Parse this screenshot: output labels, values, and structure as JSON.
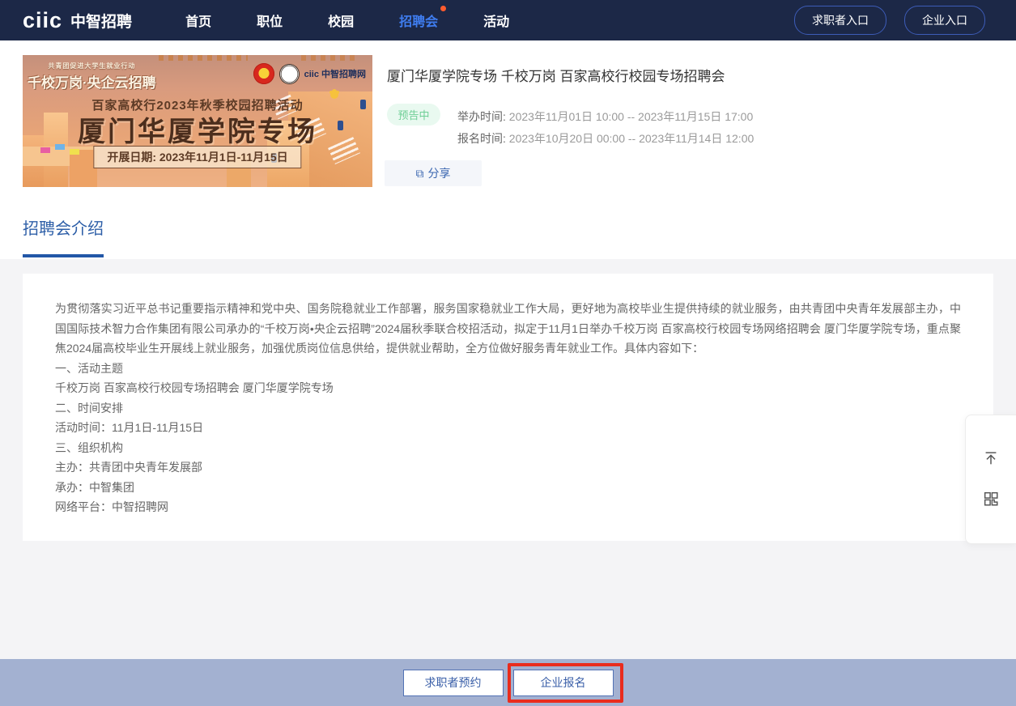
{
  "header": {
    "logo": "ciic",
    "brand": "中智招聘",
    "nav": [
      {
        "label": "首页",
        "active": false
      },
      {
        "label": "职位",
        "active": false
      },
      {
        "label": "校园",
        "active": false
      },
      {
        "label": "招聘会",
        "active": true,
        "has_dot": true
      },
      {
        "label": "活动",
        "active": false
      }
    ],
    "entry_buttons": {
      "jobseeker": "求职者入口",
      "company": "企业入口"
    }
  },
  "banner": {
    "tagline_small": "共青团促进大学生就业行动",
    "tagline": "千校万岗·央企云招聘",
    "brand": "ciic 中智招聘网",
    "subtitle": "百家高校行2023年秋季校园招聘活动",
    "title": "厦门华厦学院专场",
    "date_box": "开展日期: 2023年11月1日-11月15日"
  },
  "event": {
    "title": "厦门华厦学院专场 千校万岗 百家高校行校园专场招聘会",
    "status_badge": "预告中",
    "hold_time_label": "举办时间:",
    "hold_time_value": "2023年11月01日 10:00 -- 2023年11月15日 17:00",
    "signup_time_label": "报名时间:",
    "signup_time_value": "2023年10月20日 00:00 -- 2023年11月14日 12:00",
    "share_icon": "share-icon",
    "share_label": "分享"
  },
  "tab": {
    "intro": "招聘会介绍"
  },
  "article": {
    "lines": [
      "为贯彻落实习近平总书记重要指示精神和党中央、国务院稳就业工作部署，服务国家稳就业工作大局，更好地为高校毕业生提供持续的就业服务，由共青团中央青年发展部主办，中国国际技术智力合作集团有限公司承办的“千校万岗•央企云招聘”2024届秋季联合校招活动，拟定于11月1日举办千校万岗 百家高校行校园专场网络招聘会 厦门华厦学院专场，重点聚焦2024届高校毕业生开展线上就业服务，加强优质岗位信息供给，提供就业帮助，全方位做好服务青年就业工作。具体内容如下：",
      "一、活动主题",
      "千校万岗 百家高校行校园专场招聘会 厦门华厦学院专场",
      "二、时间安排",
      "活动时间：11月1日-11月15日",
      "三、组织机构",
      "主办：共青团中央青年发展部",
      "承办：中智集团",
      "网络平台：中智招聘网"
    ]
  },
  "floating": {
    "top_icon": "back-to-top-icon",
    "qr_icon": "qrcode-icon"
  },
  "footer": {
    "jobseeker_button": "求职者预约",
    "company_button": "企业报名"
  },
  "colors": {
    "navbar": "#1c2847",
    "nav_active": "#3f7df0",
    "nav_dot": "#ff5b2e",
    "badge_green_text": "#6fcf96",
    "badge_green_bg": "#e9f9f0",
    "tab_blue": "#2e5fa8",
    "footer_bar": "#a3b1d1",
    "button_blue": "#3a5fa8",
    "annotation_red": "#e92c1d"
  }
}
